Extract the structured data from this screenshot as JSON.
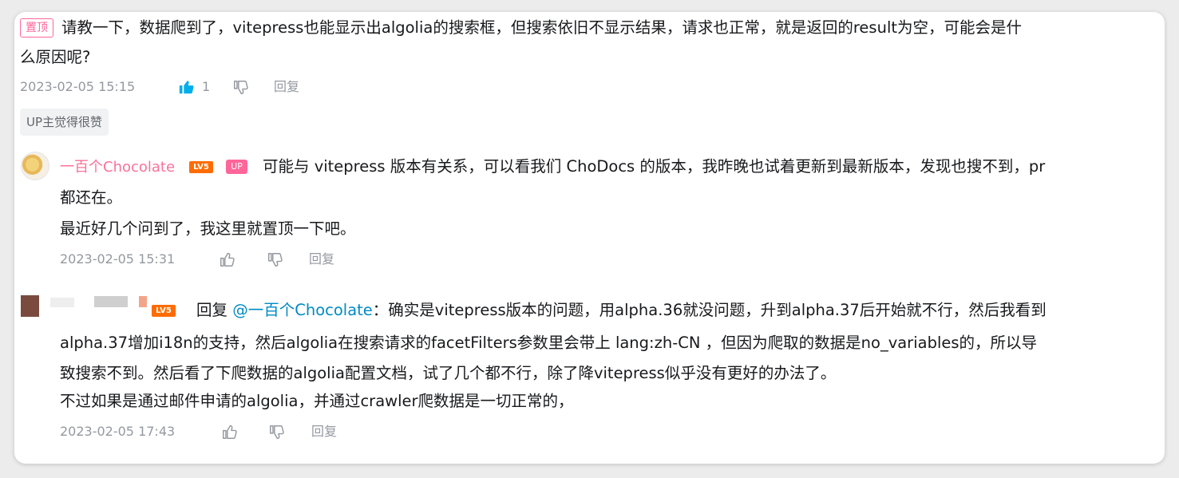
{
  "comment": {
    "pinned_badge": "置顶",
    "text_line1": "请教一下，数据爬到了，vitepress也能显示出algolia的搜索框，但搜索依旧不显示结果，请求也正常，就是返回的result为空，可能会是什",
    "text_line2": "么原因呢?",
    "timestamp": "2023-02-05 15:15",
    "like_count": "1",
    "reply_label": "回复",
    "up_liked_tag": "UP主觉得很赞"
  },
  "reply1": {
    "username": "一百个Chocolate",
    "level_badge": "LV5",
    "up_badge": "UP",
    "text_line1": "可能与 vitepress 版本有关系，可以看我们 ChoDocs 的版本，我昨晚也试着更新到最新版本，发现也搜不到，pr",
    "text_line2": "都还在。",
    "text_line3": "最近好几个问到了，我这里就置顶一下吧。",
    "timestamp": "2023-02-05 15:31",
    "reply_label": "回复"
  },
  "reply2": {
    "level_badge": "LV5",
    "reply_prefix": "回复",
    "mention": "@一百个Chocolate",
    "text_line1": "：确实是vitepress版本的问题，用alpha.36就没问题，升到alpha.37后开始就不行，然后我看到",
    "text_line2": "alpha.37增加i18n的支持，然后algolia在搜索请求的facetFilters参数里会带上 lang:zh-CN ，但因为爬取的数据是no_variables的，所以导",
    "text_line3": "致搜索不到。然后看了下爬数据的algolia配置文档，试了几个都不行，除了降vitepress似乎没有更好的办法了。",
    "text_line4": "不过如果是通过邮件申请的algolia，并通过crawler爬数据是一切正常的，",
    "timestamp": "2023-02-05 17:43",
    "reply_label": "回复"
  },
  "colors": {
    "accent_pink": "#fb7299",
    "link_blue": "#008ac5",
    "liked_blue": "#00aeec",
    "meta_gray": "#9499a0",
    "level_orange": "#ff6c00"
  },
  "icons": [
    "thumb-up-icon",
    "thumb-down-icon"
  ]
}
